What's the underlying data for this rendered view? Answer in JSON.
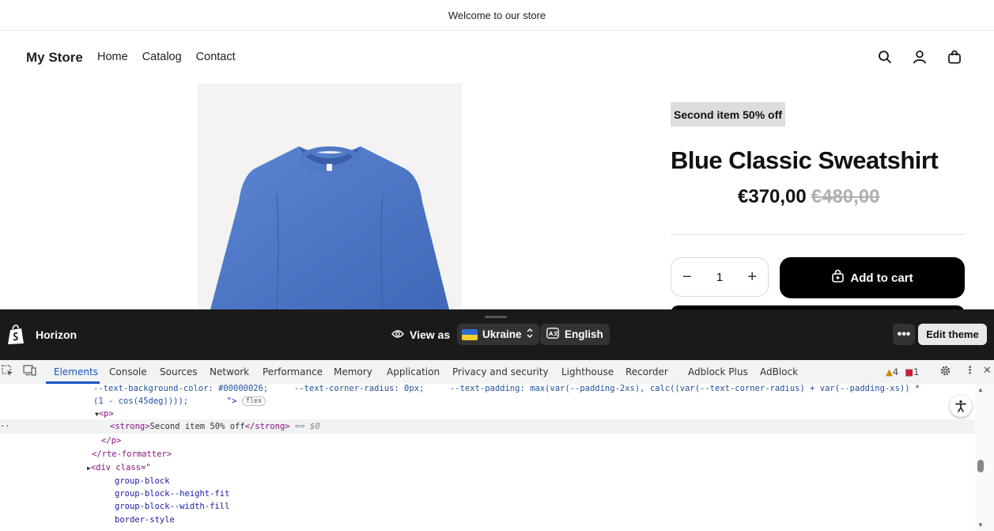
{
  "announcement": "Welcome to our store",
  "header": {
    "logo": "My Store",
    "nav": [
      "Home",
      "Catalog",
      "Contact"
    ]
  },
  "product": {
    "badge": "Second item 50% off",
    "title": "Blue Classic Sweatshirt",
    "price": "€370,00",
    "compare_price": "€480,00",
    "quantity": "1",
    "add_to_cart": "Add to cart"
  },
  "shopify_bar": {
    "theme": "Horizon",
    "view_as": "View as",
    "country": "Ukraine",
    "language": "English",
    "more": "•••",
    "edit_theme": "Edit theme"
  },
  "devtools": {
    "tabs": [
      "Elements",
      "Console",
      "Sources",
      "Network",
      "Performance",
      "Memory",
      "Application",
      "Privacy and security",
      "Lighthouse",
      "Recorder",
      "Adblock Plus",
      "AdBlock"
    ],
    "warnings": "4",
    "errors": "1",
    "lines": {
      "l1a": "--text-background-color: #00000026;",
      "l1b": "--text-corner-radius: 0px;",
      "l1c": "--text-padding: max(var(--padding-2xs), calc((var(--text-corner-radius) + var(--padding-xs)) *",
      "l2a": "(1 - cos(45deg))));",
      "l2b": "\">",
      "flex": "flex",
      "p_open": "<p>",
      "strong_open": "<strong>",
      "strong_text": "Second item 50% off",
      "strong_close": "</strong>",
      "eq": "== $0",
      "p_close": "</p>",
      "rte_close": "</rte-formatter>",
      "div_open": "<div class=\"",
      "c1": "group-block",
      "c2": "group-block--height-fit",
      "c3": "group-block--width-fill",
      "c4": "border-style"
    }
  }
}
